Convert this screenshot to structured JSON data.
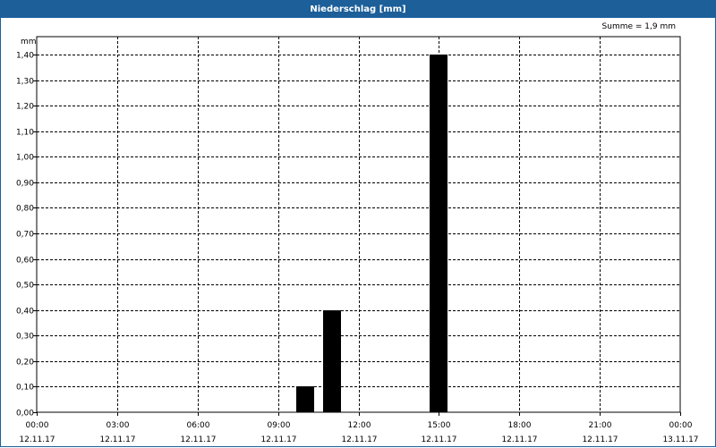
{
  "window": {
    "title": "Niederschlag [mm]"
  },
  "summary": "Summe = 1,9 mm",
  "chart_data": {
    "type": "bar",
    "unit_label": "mm",
    "ylim": [
      0,
      1.4
    ],
    "y_ticks": [
      "0,00",
      "0,10",
      "0,20",
      "0,30",
      "0,40",
      "0,50",
      "0,60",
      "0,70",
      "0,80",
      "0,90",
      "1,00",
      "1,10",
      "1,20",
      "1,30",
      "1,40"
    ],
    "x_range_hours": [
      0,
      24
    ],
    "x_ticks": [
      {
        "time": "00:00",
        "date": "12.11.17"
      },
      {
        "time": "03:00",
        "date": "12.11.17"
      },
      {
        "time": "06:00",
        "date": "12.11.17"
      },
      {
        "time": "09:00",
        "date": "12.11.17"
      },
      {
        "time": "12:00",
        "date": "12.11.17"
      },
      {
        "time": "15:00",
        "date": "12.11.17"
      },
      {
        "time": "18:00",
        "date": "12.11.17"
      },
      {
        "time": "21:00",
        "date": "12.11.17"
      },
      {
        "time": "00:00",
        "date": "13.11.17"
      }
    ],
    "bars": [
      {
        "time": "10:00",
        "value": 0.1
      },
      {
        "time": "11:00",
        "value": 0.4
      },
      {
        "time": "15:00",
        "value": 1.4
      }
    ],
    "grid": true,
    "bar_color": "#000000"
  }
}
